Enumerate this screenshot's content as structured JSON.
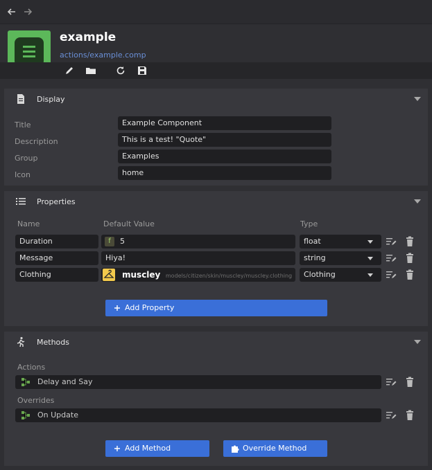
{
  "nav": {
    "back_icon": "arrow-left-icon",
    "forward_icon": "arrow-right-icon"
  },
  "header": {
    "title": "example",
    "path": "actions/example.comp",
    "icon": "document-lines-icon",
    "toolbar": [
      "pencil-icon",
      "folder-icon",
      "refresh-icon",
      "save-icon"
    ]
  },
  "display": {
    "title": "Display",
    "icon": "document-icon",
    "fields": [
      {
        "label": "Title",
        "value": "Example Component"
      },
      {
        "label": "Description",
        "value": "This is a test! \"Quote\""
      },
      {
        "label": "Group",
        "value": "Examples"
      },
      {
        "label": "Icon",
        "value": "home"
      }
    ]
  },
  "properties": {
    "title": "Properties",
    "icon": "list-icon",
    "columns": {
      "name": "Name",
      "default": "Default Value",
      "type": "Type"
    },
    "rows": [
      {
        "name": "Duration",
        "badge": "f",
        "default": "5",
        "type": "float"
      },
      {
        "name": "Message",
        "default": "Hiya!",
        "type": "string"
      },
      {
        "name": "Clothing",
        "asset_name": "muscley",
        "asset_path": "models/citizen/skin/muscley/muscley.clothing",
        "type": "Clothing"
      }
    ],
    "add_button": "Add Property"
  },
  "methods": {
    "title": "Methods",
    "icon": "running-person-icon",
    "actions_label": "Actions",
    "actions": [
      {
        "name": "Delay and Say"
      }
    ],
    "overrides_label": "Overrides",
    "overrides": [
      {
        "name": "On Update"
      }
    ],
    "add_method": "Add Method",
    "override_method": "Override Method"
  },
  "colors": {
    "accent": "#3a6fd8",
    "icon_green": "#5cb85a",
    "path_link": "#6a8fd6",
    "badge_yellow": "#f2c94c"
  }
}
